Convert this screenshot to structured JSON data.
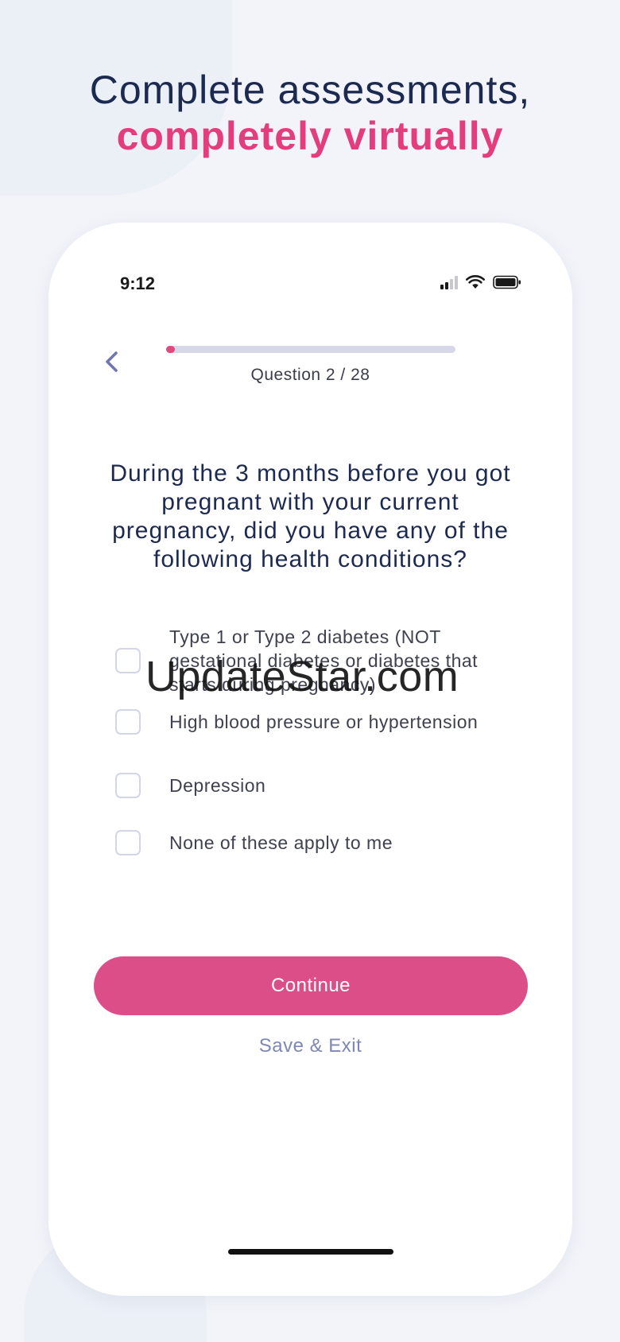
{
  "headline": {
    "line1": "Complete assessments,",
    "line2": "completely virtually"
  },
  "colors": {
    "navy": "#1c2951",
    "accent_pink": "#e43d7e",
    "button_pink": "#dc4e88",
    "link_lavender": "#7e87b6",
    "progress_track": "#d6d8ea"
  },
  "status_bar": {
    "time": "9:12",
    "icons": [
      "cellular-signal-icon",
      "wifi-icon",
      "battery-icon"
    ]
  },
  "nav": {
    "back_icon": "chevron-left-icon"
  },
  "progress": {
    "current": 2,
    "total": 28,
    "label": "Question 2 / 28",
    "fraction": 0.02
  },
  "question": {
    "text": "During the 3 months before you got pregnant with your current pregnancy, did you have any of the following health conditions?"
  },
  "options": [
    {
      "label": "Type 1 or Type 2 diabetes (NOT gestational diabetes or diabetes that starts during pregnancy)",
      "checked": false
    },
    {
      "label": "High blood pressure or hypertension",
      "checked": false
    },
    {
      "label": "Depression",
      "checked": false
    },
    {
      "label": "None of these apply to me",
      "checked": false
    }
  ],
  "actions": {
    "continue_label": "Continue",
    "save_exit_label": "Save & Exit"
  },
  "watermark": "UpdateStar.com"
}
